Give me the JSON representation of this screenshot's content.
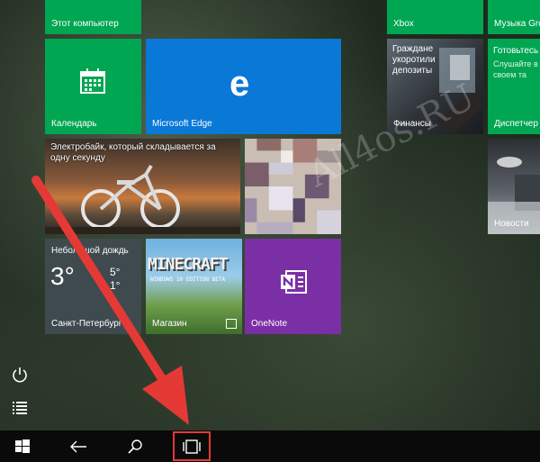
{
  "tiles": {
    "this_pc": "Этот компьютер",
    "calendar": "Календарь",
    "edge": "Microsoft Edge",
    "news_story": "Электробайк, который складывается за одну секунду",
    "weather_condition": "Небольшой дождь",
    "weather_temp": "3°",
    "weather_hi": "5°",
    "weather_lo": "1°",
    "weather_city": "Санкт-Петербург",
    "store_banner": "MINECRAFT",
    "store_banner_sub": "WINDOWS 10 EDITION BETA",
    "store": "Магазин",
    "onenote": "OneNote",
    "xbox": "Xbox",
    "finance_headline": "Граждане укоротили депозиты",
    "finance": "Финансы",
    "music": "Музыка Groove",
    "dispatcher_title": "Готовьтесь",
    "dispatcher_text": "Слушайте в своем та",
    "dispatcher": "Диспетчер",
    "news": "Новости"
  },
  "watermark": "All4os.RU",
  "colors": {
    "tile_green": "#00a651",
    "tile_blue": "#0a78d7",
    "tile_purple": "#7b2fa5",
    "highlight": "#e53935"
  },
  "rail_icons": [
    "power-icon",
    "all-apps-icon"
  ],
  "taskbar_icons": [
    "windows-start-icon",
    "back-arrow-icon",
    "search-icon",
    "task-view-icon"
  ],
  "annotation": {
    "highlighted_button": "task-view",
    "arrow_color": "#e53935"
  }
}
